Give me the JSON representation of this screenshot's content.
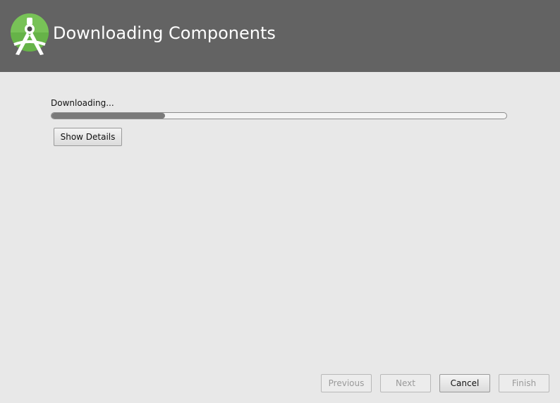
{
  "header": {
    "title": "Downloading Components",
    "logo_icon": "android-studio-logo-icon",
    "background_color": "#636363",
    "accent_color": "#78c257"
  },
  "main": {
    "status_text": "Downloading...",
    "progress": 0.25,
    "show_details_label": "Show Details"
  },
  "footer": {
    "previous_label": "Previous",
    "next_label": "Next",
    "cancel_label": "Cancel",
    "finish_label": "Finish"
  }
}
